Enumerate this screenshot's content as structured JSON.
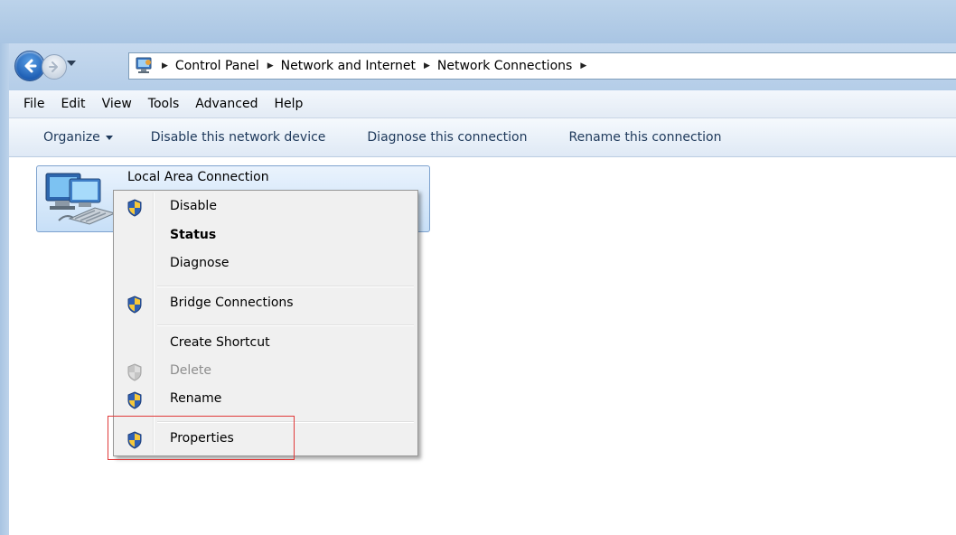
{
  "address_bar": {
    "breadcrumbs": [
      "Control Panel",
      "Network and Internet",
      "Network Connections"
    ]
  },
  "menubar": {
    "items": [
      "File",
      "Edit",
      "View",
      "Tools",
      "Advanced",
      "Help"
    ]
  },
  "command_bar": {
    "organize": "Organize",
    "disable": "Disable this network device",
    "diagnose": "Diagnose this connection",
    "rename": "Rename this connection"
  },
  "connection": {
    "name": "Local Area Connection"
  },
  "context_menu": {
    "items": [
      {
        "label": "Disable",
        "icon": "uac-shield-icon"
      },
      {
        "label": "Status",
        "icon": ""
      },
      {
        "label": "Diagnose",
        "icon": ""
      },
      {
        "label": "Bridge Connections",
        "icon": "uac-shield-icon"
      },
      {
        "label": "Create Shortcut",
        "icon": ""
      },
      {
        "label": "Delete",
        "icon": "uac-shield-icon-disabled"
      },
      {
        "label": "Rename",
        "icon": "uac-shield-icon"
      },
      {
        "label": "Properties",
        "icon": "uac-shield-icon"
      }
    ]
  },
  "colors": {
    "highlight_box": "#e03a3a",
    "command_text": "#1e395b",
    "tile_border": "#7da2ce"
  }
}
